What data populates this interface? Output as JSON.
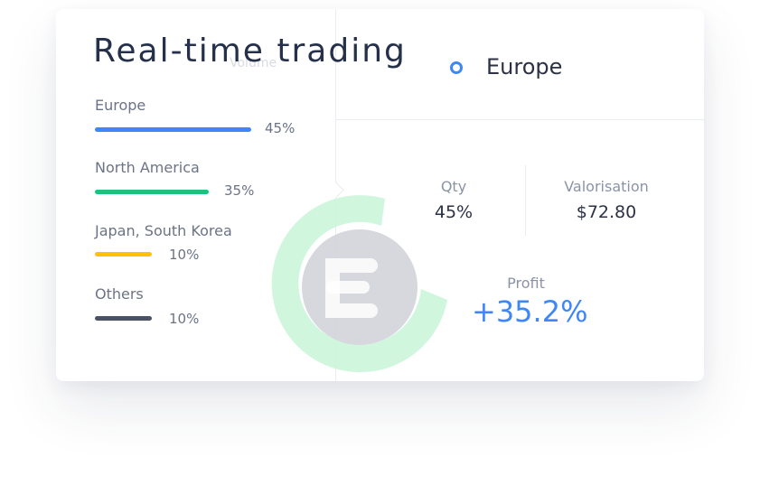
{
  "header": {
    "title": "Real-time trading",
    "faint_tab": "Volume"
  },
  "regions": [
    {
      "name": "Europe",
      "percent": "45%",
      "share": 0.45,
      "color": "#3f86f6"
    },
    {
      "name": "North America",
      "percent": "35%",
      "share": 0.35,
      "color": "#22c07e"
    },
    {
      "name": "Japan, South Korea",
      "percent": "10%",
      "share": 0.1,
      "color": "#ffc107"
    },
    {
      "name": "Others",
      "percent": "10%",
      "share": 0.1,
      "color": "#4b5264"
    }
  ],
  "detail": {
    "region": "Europe",
    "qty_label": "Qty",
    "qty_value": "45%",
    "valorisation_label": "Valorisation",
    "valorisation_value": "$72.80",
    "profit_label": "Profit",
    "profit_value": "+35.2%",
    "accent_color": "#3f86f6"
  },
  "watermark": {
    "icon": "e-logo-icon",
    "ring_color": "#c8f5d8",
    "letter_color": "#d2d4da"
  }
}
